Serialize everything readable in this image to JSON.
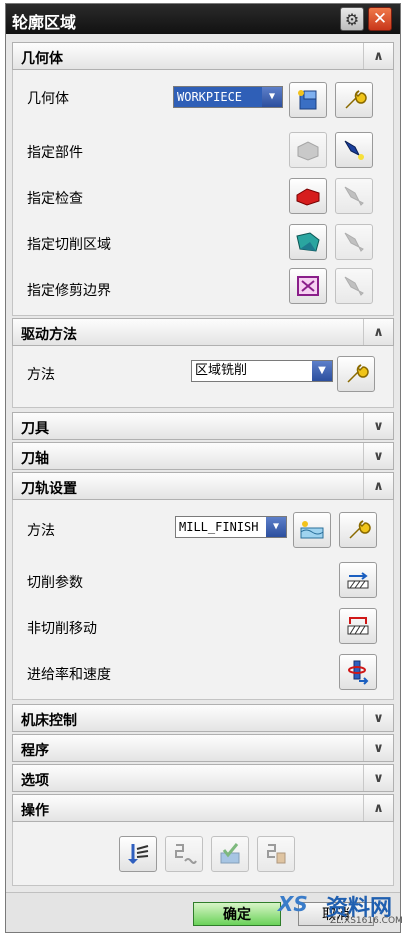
{
  "window": {
    "title": "轮廓区域",
    "gear_icon": "gear-icon",
    "close_icon": "close-icon",
    "close_glyph": "✕",
    "gear_glyph": "⚙"
  },
  "sections": {
    "geometry": {
      "label": "几何体",
      "state": "expanded",
      "chev": "∧"
    },
    "drive": {
      "label": "驱动方法",
      "state": "expanded",
      "chev": "∧"
    },
    "tool": {
      "label": "刀具",
      "state": "collapsed",
      "chev": "∨"
    },
    "axis": {
      "label": "刀轴",
      "state": "collapsed",
      "chev": "∨"
    },
    "toolpath": {
      "label": "刀轨设置",
      "state": "expanded",
      "chev": "∧"
    },
    "machine": {
      "label": "机床控制",
      "state": "collapsed",
      "chev": "∨"
    },
    "program": {
      "label": "程序",
      "state": "collapsed",
      "chev": "∨"
    },
    "options": {
      "label": "选项",
      "state": "collapsed",
      "chev": "∨"
    },
    "actions": {
      "label": "操作",
      "state": "expanded",
      "chev": "∧"
    }
  },
  "geometry": {
    "geom_label": "几何体",
    "geom_value": "WORKPIECE",
    "part_label": "指定部件",
    "check_label": "指定检查",
    "cut_area_label": "指定切削区域",
    "trim_label": "指定修剪边界"
  },
  "drive": {
    "method_label": "方法",
    "method_value": "区域铣削"
  },
  "toolpath": {
    "method_label": "方法",
    "method_value": "MILL_FINISH",
    "cut_params_label": "切削参数",
    "noncut_label": "非切削移动",
    "feeds_label": "进给率和速度"
  },
  "footer": {
    "ok_label": "确定",
    "cancel_label": "取消"
  },
  "watermark": {
    "logo": "XS",
    "text": "资料网",
    "url": "ZL.XS1616.COM"
  },
  "colors": {
    "title_bg": "#1a1a1a",
    "ok_green": "#6bd25a",
    "dropdown_blue": "#2c4f9e"
  }
}
